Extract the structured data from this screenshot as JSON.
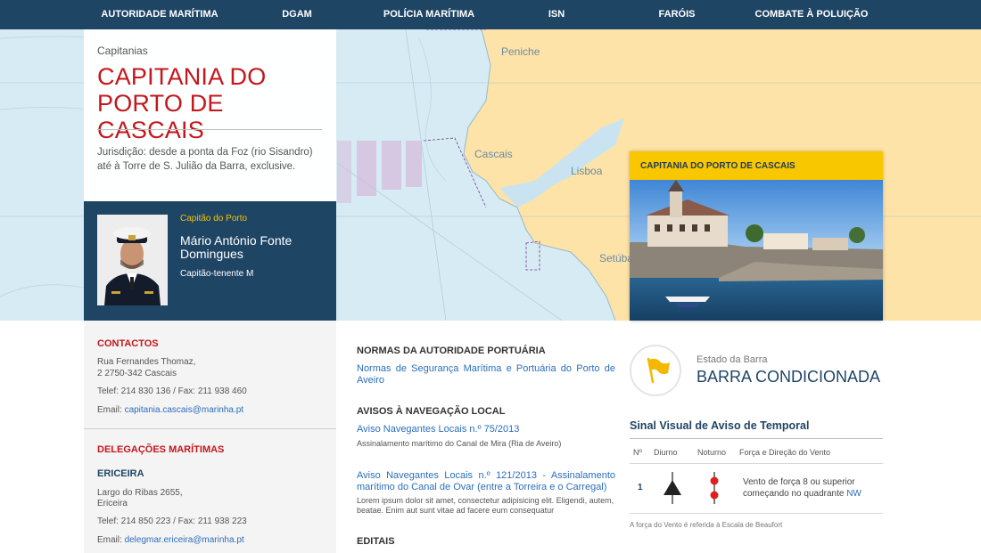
{
  "nav": {
    "items": [
      "AUTORIDADE MARÍTIMA",
      "DGAM",
      "POLÍCIA MARÍTIMA",
      "ISN",
      "FARÓIS",
      "COMBATE À POLUIÇÃO"
    ]
  },
  "map": {
    "labels": [
      "Peniche",
      "Cascais",
      "Lisboa",
      "Setúba"
    ]
  },
  "header": {
    "breadcrumb": "Capitanias",
    "title_line1": "CAPITANIA DO",
    "title_line2": "PORTO DE CASCAIS",
    "jurisdiction": "Jurisdição: desde a ponta da Foz (rio Sisandro) até à Torre de S. Julião da Barra, exclusive."
  },
  "captain": {
    "role": "Capitão do Porto",
    "name": "Mário António Fonte Domingues",
    "rank": "Capitão-tenente M"
  },
  "featured": {
    "title": "CAPITANIA DO PORTO DE CASCAIS"
  },
  "contacts": {
    "title": "CONTACTOS",
    "address_line1": "Rua Fernandes Thomaz,",
    "address_line2": "2 2750-342 Cascais",
    "phone": "Telef: 214 830 136 / Fax: 211 938 460",
    "email_label": "Email: ",
    "email": "capitania.cascais@marinha.pt"
  },
  "delegations": {
    "title": "DELEGAÇÕES MARÍTIMAS",
    "name": "ERICEIRA",
    "address_line1": "Largo do Ribas 2655,",
    "address_line2": "Ericeira",
    "phone": "Telef: 214 850 223 / Fax: 211 938 223",
    "email_label": "Email: ",
    "email": "delegmar.ericeira@marinha.pt"
  },
  "middle": {
    "normas_title": "NORMAS DA AUTORIDADE PORTUÁRIA",
    "normas_link": "Normas de Segurança Marítima e Portuária do Porto de Aveiro",
    "avisos_title": "AVISOS À NAVEGAÇÃO LOCAL",
    "aviso1_link": "Aviso Navegantes Locais n.º 75/2013",
    "aviso1_desc": "Assinalamento marítimo do Canal de Mira (Ria de Aveiro)",
    "aviso2_link": "Aviso Navegantes Locais n.º 121/2013 - Assinalamento marítimo do Canal de Ovar (entre a Torreira e o Carregal)",
    "aviso2_desc": "Lorem ipsum dolor sit amet, consectetur adipisicing elit. Eligendi, autem, beatae. Enim aut sunt vitae ad facere eum consequatur",
    "editais_title": "EDITAIS"
  },
  "bar_state": {
    "label": "Estado da Barra",
    "status": "BARRA CONDICIONADA",
    "icon": "flag-icon",
    "icon_color": "#f5b800"
  },
  "storm_signal": {
    "title": "Sinal Visual de Aviso de Temporal",
    "columns": [
      "Nº",
      "Diurno",
      "Noturno",
      "Força e Direção do Vento"
    ],
    "rows": [
      {
        "num": "1",
        "desc": "Vento de força 8 ou superior começando no quadrante",
        "dir": "NW"
      }
    ],
    "footnote": "A força do Vento é referida à Escala de Beaufort"
  },
  "colors": {
    "navy": "#1f4565",
    "red": "#c4161c",
    "yellow": "#f8c700",
    "link": "#2a6ebb",
    "sea": "#d6ebf3",
    "land": "#fde3a7"
  }
}
